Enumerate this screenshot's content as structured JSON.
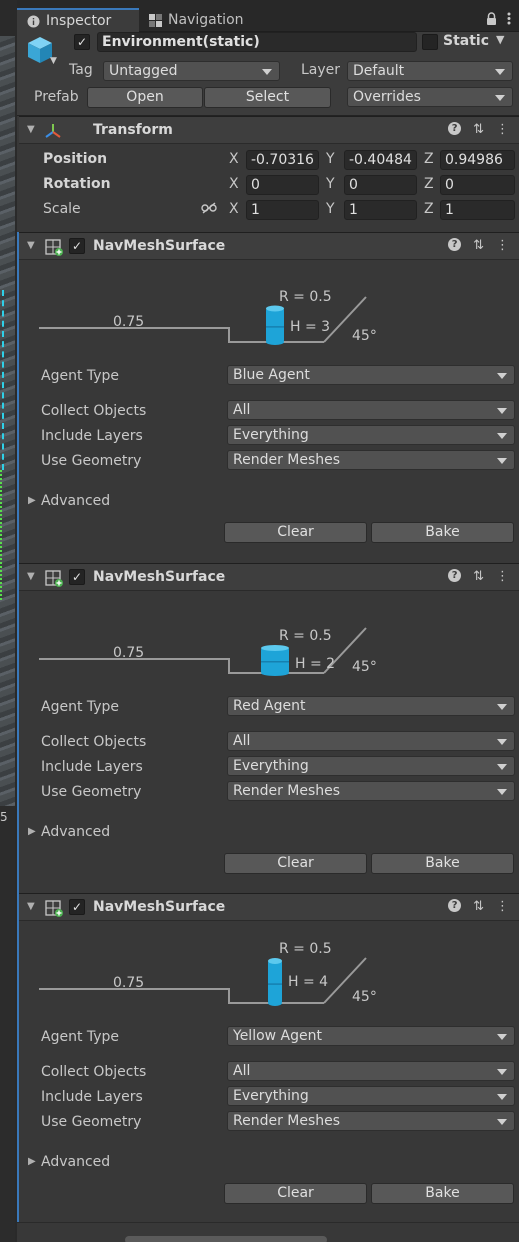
{
  "left_strip": {
    "value": "5"
  },
  "tabs": [
    {
      "label": "Inspector"
    },
    {
      "label": "Navigation"
    }
  ],
  "header": {
    "object_name": "Environment(static)",
    "static_label": "Static",
    "tag_label": "Tag",
    "tag_value": "Untagged",
    "layer_label": "Layer",
    "layer_value": "Default",
    "prefab_label": "Prefab",
    "open_label": "Open",
    "select_label": "Select",
    "overrides_label": "Overrides"
  },
  "transform": {
    "title": "Transform",
    "position_label": "Position",
    "rotation_label": "Rotation",
    "scale_label": "Scale",
    "axis_x": "X",
    "axis_y": "Y",
    "axis_z": "Z",
    "position": {
      "x": "-0.70316",
      "y": "-0.40484",
      "z": "0.94986"
    },
    "rotation": {
      "x": "0",
      "y": "0",
      "z": "0"
    },
    "scale": {
      "x": "1",
      "y": "1",
      "z": "1"
    }
  },
  "navmesh_surfaces": [
    {
      "title": "NavMeshSurface",
      "radius_text": "R = 0.5",
      "height_text": "H = 3",
      "step_text": "0.75",
      "slope_text": "45°",
      "agent_type_label": "Agent Type",
      "agent_type": "Blue Agent",
      "collect_label": "Collect Objects",
      "collect": "All",
      "layers_label": "Include Layers",
      "layers": "Everything",
      "geometry_label": "Use Geometry",
      "geometry": "Render Meshes",
      "advanced_label": "Advanced",
      "clear_label": "Clear",
      "bake_label": "Bake"
    },
    {
      "title": "NavMeshSurface",
      "radius_text": "R = 0.5",
      "height_text": "H = 2",
      "step_text": "0.75",
      "slope_text": "45°",
      "agent_type_label": "Agent Type",
      "agent_type": "Red Agent",
      "collect_label": "Collect Objects",
      "collect": "All",
      "layers_label": "Include Layers",
      "layers": "Everything",
      "geometry_label": "Use Geometry",
      "geometry": "Render Meshes",
      "advanced_label": "Advanced",
      "clear_label": "Clear",
      "bake_label": "Bake"
    },
    {
      "title": "NavMeshSurface",
      "radius_text": "R = 0.5",
      "height_text": "H = 4",
      "step_text": "0.75",
      "slope_text": "45°",
      "agent_type_label": "Agent Type",
      "agent_type": "Yellow Agent",
      "collect_label": "Collect Objects",
      "collect": "All",
      "layers_label": "Include Layers",
      "layers": "Everything",
      "geometry_label": "Use Geometry",
      "geometry": "Render Meshes",
      "advanced_label": "Advanced",
      "clear_label": "Clear",
      "bake_label": "Bake"
    }
  ],
  "colors": {
    "accent": "#3a79bb",
    "agent_cylinder": "#1ea4d8"
  }
}
